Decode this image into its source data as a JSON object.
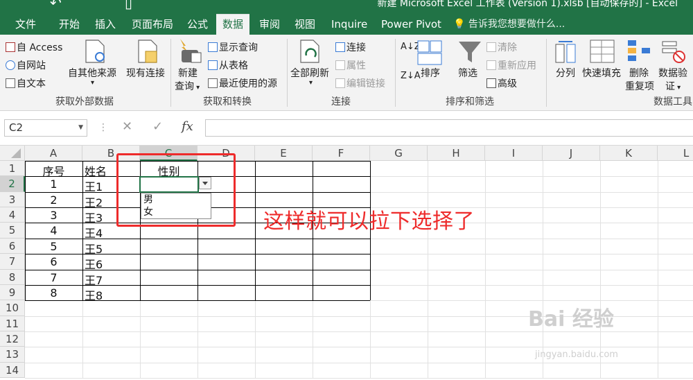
{
  "window": {
    "title": "新建 Microsoft Excel 工作表 (Version 1).xlsb [自动保存的] - Excel"
  },
  "tabs": [
    {
      "label": "文件"
    },
    {
      "label": "开始"
    },
    {
      "label": "插入"
    },
    {
      "label": "页面布局"
    },
    {
      "label": "公式"
    },
    {
      "label": "数据",
      "active": true
    },
    {
      "label": "审阅"
    },
    {
      "label": "视图"
    },
    {
      "label": "Inquire"
    },
    {
      "label": "Power Pivot"
    }
  ],
  "tell_me": "告诉我您想要做什么...",
  "ribbon": {
    "external": {
      "access": "自 Access",
      "web": "自网站",
      "text": "自文本",
      "other_1": "自其他来源",
      "existing": "现有连接",
      "label": "获取外部数据"
    },
    "transform": {
      "new_query_1": "新建",
      "new_query_2": "查询",
      "show_queries": "显示查询",
      "from_table": "从表格",
      "recent_sources": "最近使用的源",
      "label": "获取和转换"
    },
    "connections": {
      "refresh_all": "全部刷新",
      "connections": "连接",
      "properties": "属性",
      "edit_links": "编辑链接",
      "label": "连接"
    },
    "sort_filter": {
      "sort": "排序",
      "filter": "筛选",
      "clear": "清除",
      "reapply": "重新应用",
      "advanced": "高级",
      "label": "排序和筛选"
    },
    "data_tools": {
      "split": "分列",
      "flash_fill": "快速填充",
      "remove_dup_1": "删除",
      "remove_dup_2": "重复项",
      "validation_1": "数据验",
      "validation_2": "证",
      "label": "数据工具"
    }
  },
  "formula_bar": {
    "name_box": "C2",
    "fx": "fx",
    "content": ""
  },
  "grid": {
    "columns": [
      "A",
      "B",
      "C",
      "D",
      "E",
      "F",
      "G",
      "H",
      "I",
      "J",
      "K",
      "L"
    ],
    "rows": [
      "1",
      "2",
      "3",
      "4",
      "5",
      "6",
      "7",
      "8",
      "9",
      "10",
      "11",
      "12",
      "13",
      "14"
    ],
    "active_cell": "C2",
    "header_row": [
      "序号",
      "姓名",
      "性别"
    ],
    "data_rows": [
      [
        "1",
        "王1"
      ],
      [
        "2",
        "王2"
      ],
      [
        "3",
        "王3"
      ],
      [
        "4",
        "王4"
      ],
      [
        "5",
        "王5"
      ],
      [
        "6",
        "王6"
      ],
      [
        "7",
        "王7"
      ],
      [
        "8",
        "王8"
      ]
    ]
  },
  "dropdown": {
    "options": [
      "男",
      "女"
    ]
  },
  "annotation": "这样就可以拉下选择了",
  "watermark": {
    "main": "Bai 经验",
    "sub": "jingyan.baidu.com"
  },
  "colors": {
    "excel_green": "#217346",
    "annotation_red": "#ee2b2b"
  }
}
